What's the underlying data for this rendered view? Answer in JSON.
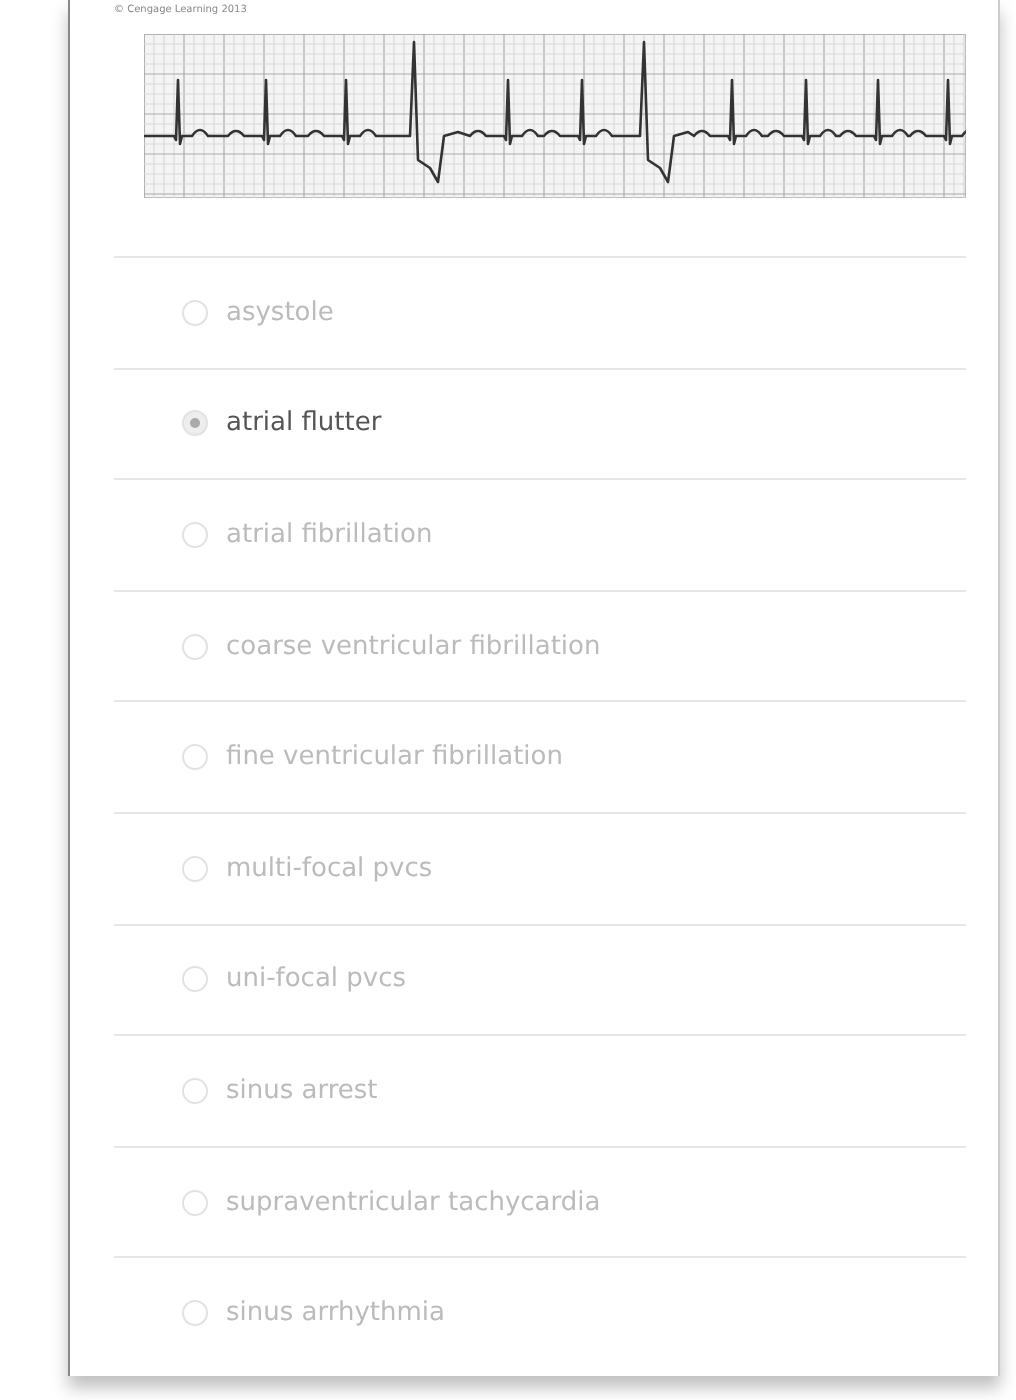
{
  "figure": {
    "credit": "© Cengage Learning 2013"
  },
  "options": [
    {
      "label": "asystole",
      "selected": false
    },
    {
      "label": "atrial flutter",
      "selected": true
    },
    {
      "label": "atrial fibrillation",
      "selected": false
    },
    {
      "label": "coarse ventricular fibrillation",
      "selected": false
    },
    {
      "label": "fine ventricular fibrillation",
      "selected": false
    },
    {
      "label": "multi-focal pvcs",
      "selected": false
    },
    {
      "label": "uni-focal pvcs",
      "selected": false
    },
    {
      "label": "sinus arrest",
      "selected": false
    },
    {
      "label": "supraventricular tachycardia",
      "selected": false
    },
    {
      "label": "sinus arrhythmia",
      "selected": false
    }
  ]
}
